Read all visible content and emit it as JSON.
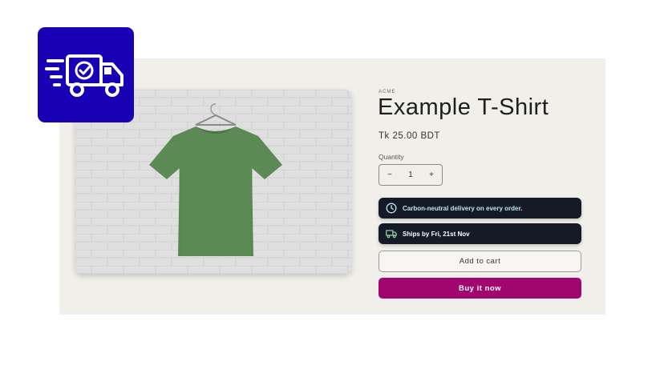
{
  "product": {
    "vendor": "ACME",
    "title": "Example T-Shirt",
    "price": "Tk 25.00 BDT",
    "image_icon": "green-tshirt-on-hanger"
  },
  "quantity": {
    "label": "Quantity",
    "value": "1",
    "decrement": "−",
    "increment": "+"
  },
  "notices": [
    {
      "text": "Carbon-neutral delivery on every order.",
      "icon": "clock-icon"
    },
    {
      "text": "Ships by Fri, 21st Nov",
      "icon": "truck-icon"
    }
  ],
  "actions": {
    "add_to_cart": "Add to cart",
    "buy_now": "Buy it now"
  },
  "badge": {
    "icon": "fast-delivery-truck-check-icon"
  },
  "colors": {
    "badge_bg": "#1a00b4",
    "buy_button": "#a0066e",
    "notice_bg": "#141a26",
    "page_bg": "#f1efe9"
  }
}
